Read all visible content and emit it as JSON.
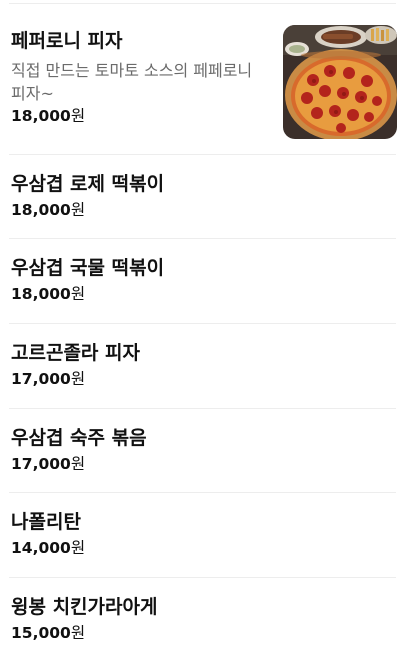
{
  "currency_unit": "원",
  "menu_items": [
    {
      "name": "페퍼로니 피자",
      "description": "직접 만드는 토마토 소스의 페페로니 피자~",
      "price": "18,000",
      "photo_icon": "pepperoni-pizza-photo"
    },
    {
      "name": "우삼겹 로제 떡볶이",
      "price": "18,000"
    },
    {
      "name": "우삼겹 국물 떡볶이",
      "price": "18,000"
    },
    {
      "name": "고르곤졸라 피자",
      "price": "17,000"
    },
    {
      "name": "우삼겹 숙주 볶음",
      "price": "17,000"
    },
    {
      "name": "나폴리탄",
      "price": "14,000"
    },
    {
      "name": "윙봉 치킨가라아게",
      "price": "15,000"
    }
  ],
  "colors": {
    "text": "#111111",
    "description": "#6b6b6b",
    "divider": "#ededed"
  }
}
